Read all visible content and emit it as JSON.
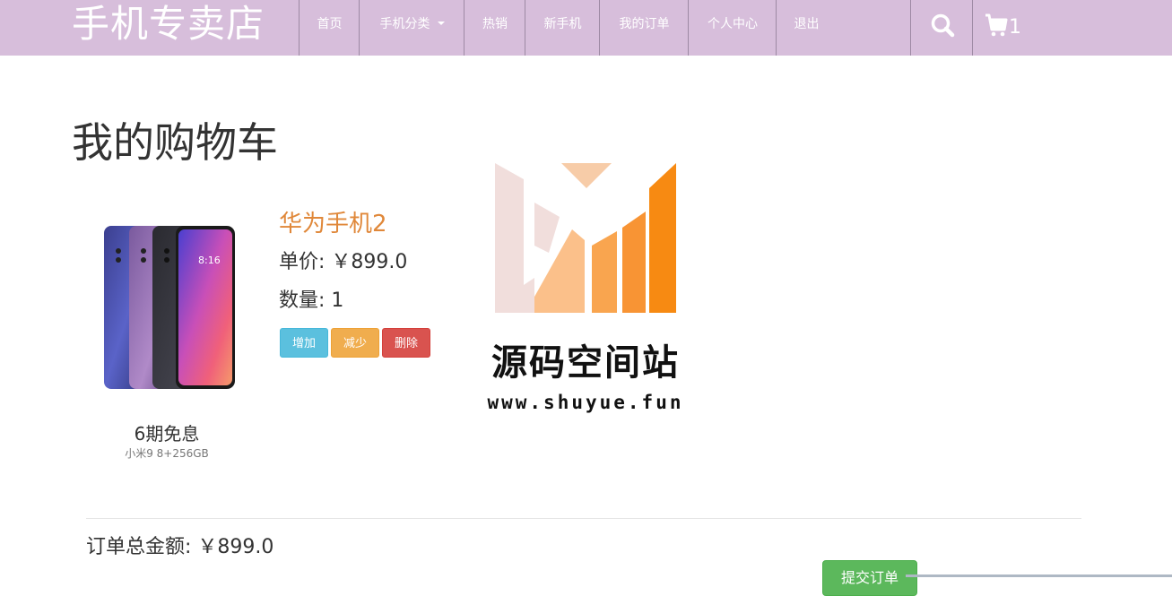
{
  "navbar": {
    "brand": "手机专卖店",
    "items": [
      {
        "label": "首页"
      },
      {
        "label": "手机分类"
      },
      {
        "label": "热销"
      },
      {
        "label": "新手机"
      },
      {
        "label": "我的订单"
      },
      {
        "label": "个人中心"
      },
      {
        "label": "退出"
      }
    ],
    "search_icon": "search-icon",
    "cart_icon": "cart-icon",
    "cart_count": "1"
  },
  "page": {
    "title": "我的购物车"
  },
  "cart": {
    "items": [
      {
        "name": "华为手机2",
        "price": "单价: ￥899.0",
        "quantity": "数量: 1",
        "image_caption": "6期免息",
        "image_subcaption": "小米9  8+256GB",
        "buttons": {
          "add": "增加",
          "decrease": "减少",
          "delete": "删除"
        }
      }
    ],
    "total": "订单总金额: ￥899.0",
    "submit": "提交订单"
  },
  "watermark": {
    "title": "源码空间站",
    "url": "www.shuyue.fun"
  },
  "colors": {
    "navbar_bg": "#d7bedb",
    "product_name": "#e0883a",
    "btn_add": "#5bc0de",
    "btn_decrease": "#f0ad4e",
    "btn_delete": "#d9534f",
    "btn_submit": "#5cb85c"
  }
}
